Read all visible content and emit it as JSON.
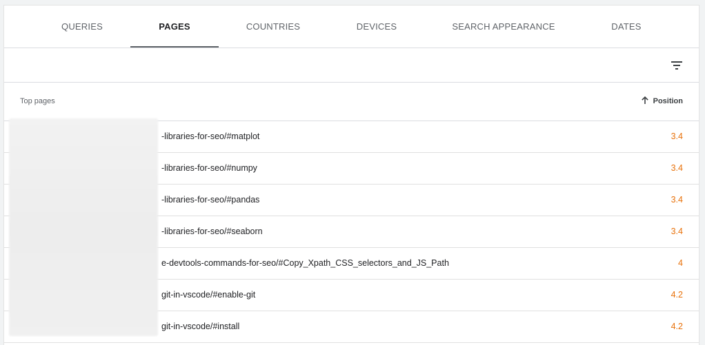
{
  "tabs": [
    {
      "label": "QUERIES"
    },
    {
      "label": "PAGES"
    },
    {
      "label": "COUNTRIES"
    },
    {
      "label": "DEVICES"
    },
    {
      "label": "SEARCH APPEARANCE"
    },
    {
      "label": "DATES"
    }
  ],
  "active_tab": "PAGES",
  "toolbar": {
    "filter_icon": "filter-list-icon"
  },
  "table": {
    "headers": {
      "page": "Top pages",
      "position": "Position"
    },
    "sort": {
      "column": "Position",
      "direction": "ascending",
      "icon": "arrow-up-icon"
    },
    "rows": [
      {
        "url": "-libraries-for-seo/#matplot",
        "position": "3.4"
      },
      {
        "url": "-libraries-for-seo/#numpy",
        "position": "3.4"
      },
      {
        "url": "-libraries-for-seo/#pandas",
        "position": "3.4"
      },
      {
        "url": "-libraries-for-seo/#seaborn",
        "position": "3.4"
      },
      {
        "url": "e-devtools-commands-for-seo/#Copy_Xpath_CSS_selectors_and_JS_Path",
        "position": "4"
      },
      {
        "url": "git-in-vscode/#enable-git",
        "position": "4.2"
      },
      {
        "url": "git-in-vscode/#install",
        "position": "4.2"
      }
    ]
  },
  "colors": {
    "position_value": "#e8710a",
    "active_tab_underline": "#5f6368"
  }
}
